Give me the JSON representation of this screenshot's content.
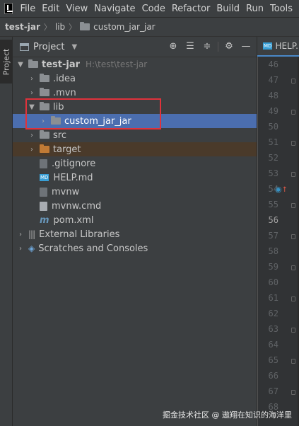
{
  "menu": {
    "logo_icon": "intellij-logo-icon",
    "items": [
      "File",
      "Edit",
      "View",
      "Navigate",
      "Code",
      "Refactor",
      "Build",
      "Run",
      "Tools"
    ]
  },
  "breadcrumb": {
    "project": "test-jar",
    "folder1": "lib",
    "folder2": "custom_jar_jar"
  },
  "side_stripe": {
    "label": "Project"
  },
  "project_window": {
    "title": "Project",
    "actions": [
      "crosshair-icon",
      "expand-all-icon",
      "collapse-all-icon",
      "gear-icon",
      "minimize-icon"
    ]
  },
  "tree": {
    "root": {
      "name": "test-jar",
      "path": "H:\\test\\test-jar"
    },
    "idea": ".idea",
    "mvn": ".mvn",
    "lib": "lib",
    "custom": "custom_jar_jar",
    "src": "src",
    "target": "target",
    "gitignore": ".gitignore",
    "help": "HELP.md",
    "mvnw": "mvnw",
    "mvnw_cmd": "mvnw.cmd",
    "pom": "pom.xml",
    "external": "External Libraries",
    "scratches": "Scratches and Consoles"
  },
  "editor": {
    "tab_label": "HELP.",
    "tab_badge": "MD",
    "line_numbers": [
      "46",
      "47",
      "48",
      "49",
      "50",
      "51",
      "52",
      "53",
      "54",
      "55",
      "56",
      "57",
      "58",
      "59",
      "60",
      "61",
      "62",
      "63",
      "64",
      "65",
      "66",
      "67",
      "68"
    ],
    "current_line": "56"
  },
  "watermark": "掘金技术社区 @ 遨翔在知识的海洋里",
  "colors": {
    "selection": "#4b6eaf",
    "highlight_box": "#e0323b",
    "excluded_folder": "#c07a35"
  }
}
